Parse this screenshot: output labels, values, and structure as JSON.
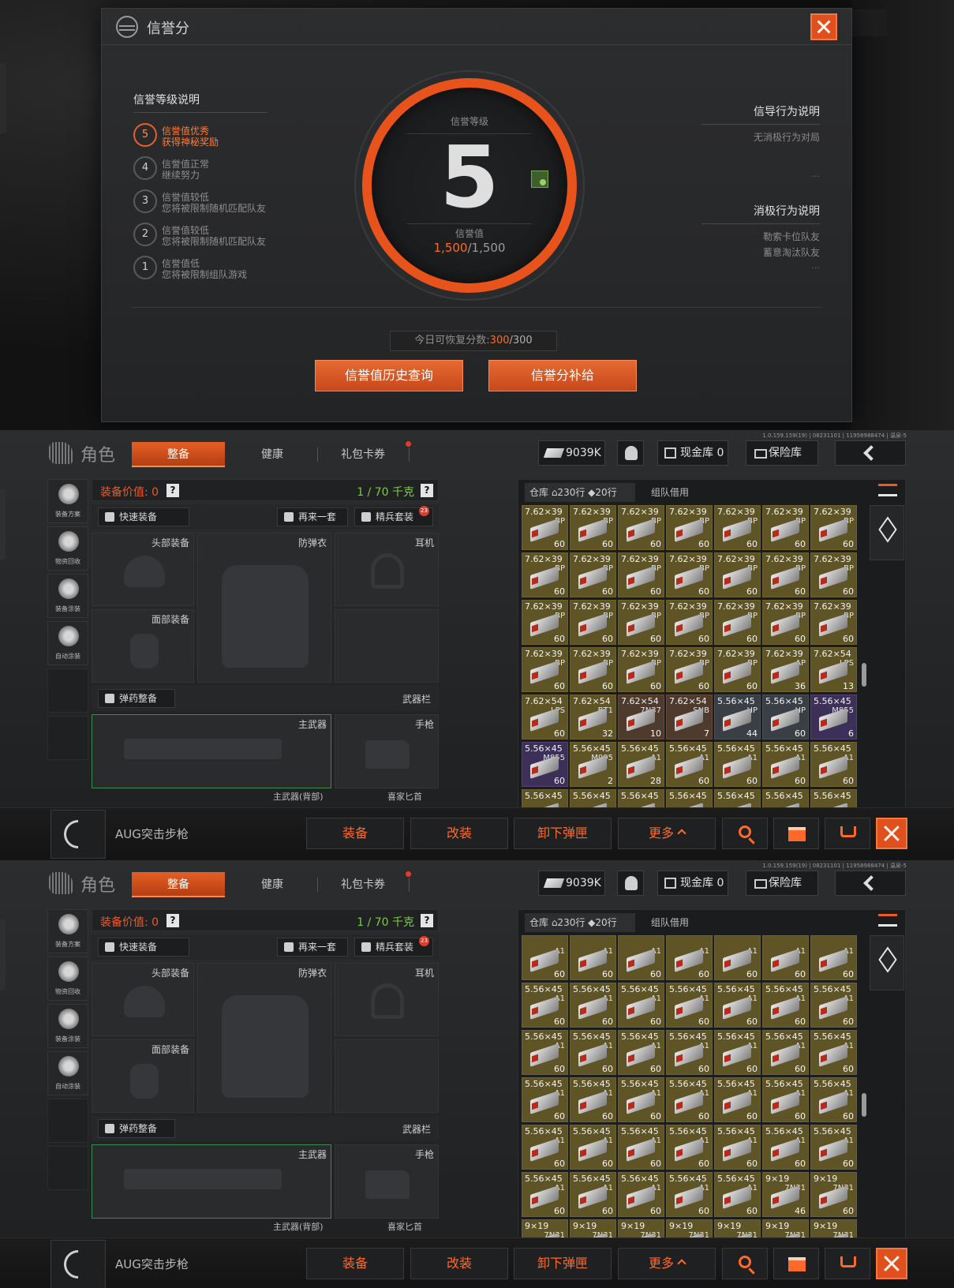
{
  "credit": {
    "title": "信誉分",
    "levels_title": "信誉等级说明",
    "levels": [
      {
        "num": "5",
        "line1": "信誉值优秀",
        "line2": "获得神秘奖励"
      },
      {
        "num": "4",
        "line1": "信誉值正常",
        "line2": "继续努力"
      },
      {
        "num": "3",
        "line1": "信誉值较低",
        "line2": "您将被限制随机匹配队友"
      },
      {
        "num": "2",
        "line1": "信誉值较低",
        "line2": "您将被限制随机匹配队友"
      },
      {
        "num": "1",
        "line1": "信誉值低",
        "line2": "您将被限制组队游戏"
      }
    ],
    "dial": {
      "level_label": "信誉等级",
      "level": "5",
      "value_label": "信誉值",
      "current": "1,500",
      "max": "/1,500"
    },
    "guide_title": "信导行为说明",
    "guide_desc": "无消极行为对局",
    "guide_more": "...",
    "negative_title": "消极行为说明",
    "negative_lines": [
      "勒索卡位队友",
      "蓄意淘汰队友"
    ],
    "negative_more": "...",
    "recover_label": "今日可恢复分数:",
    "recover_current": "300",
    "recover_max": "/300",
    "history_button": "信誉值历史查询",
    "supply_button": "信誉分补给"
  },
  "inventory": {
    "version": "1.0.159.159(19) | 08231101 | 11958988474 | 温泉-5",
    "role": "角色",
    "tabs": [
      "整备",
      "健康",
      "礼包卡券"
    ],
    "money": "9039K",
    "cash_label": "现金库 0",
    "safe_label": "保险库",
    "side_tools": [
      "装备方案",
      "物资回收",
      "装备涂装",
      "自动涂装"
    ],
    "equip_value_label": "装备价值: 0",
    "weight_label": "1 / 70 千克",
    "help": "?",
    "quick_equip": "快速装备",
    "again": "再来一套",
    "elite": "精兵套装",
    "elite_badge": "23",
    "slots": {
      "head": "头部装备",
      "armor": "防弹衣",
      "ear": "耳机",
      "face": "面部装备",
      "ammo": "弹药整备",
      "weapon_bar": "武器栏",
      "main": "主武器",
      "pistol": "手枪",
      "main_back": "主武器(背部)",
      "melee": "喜家匕首"
    },
    "stash_tab": "仓库 ⌂230行 ◆20行",
    "team_tab": "组队借用",
    "weapon_name": "AUG突击步枪",
    "actions": [
      "装备",
      "改装",
      "卸下弹匣",
      "更多"
    ],
    "panel_a_cells": [
      {
        "cal": "7.62×39",
        "code": "BP",
        "cnt": "60",
        "c": "y"
      },
      {
        "cal": "7.62×39",
        "code": "BP",
        "cnt": "60",
        "c": "y"
      },
      {
        "cal": "7.62×39",
        "code": "BP",
        "cnt": "60",
        "c": "y"
      },
      {
        "cal": "7.62×39",
        "code": "BP",
        "cnt": "60",
        "c": "y"
      },
      {
        "cal": "7.62×39",
        "code": "BP",
        "cnt": "60",
        "c": "y"
      },
      {
        "cal": "7.62×39",
        "code": "BP",
        "cnt": "60",
        "c": "y"
      },
      {
        "cal": "7.62×39",
        "code": "BP",
        "cnt": "60",
        "c": "y"
      },
      {
        "cal": "7.62×39",
        "code": "BP",
        "cnt": "60",
        "c": "y"
      },
      {
        "cal": "7.62×39",
        "code": "BP",
        "cnt": "60",
        "c": "y"
      },
      {
        "cal": "7.62×39",
        "code": "BP",
        "cnt": "60",
        "c": "y"
      },
      {
        "cal": "7.62×39",
        "code": "BP",
        "cnt": "60",
        "c": "y"
      },
      {
        "cal": "7.62×39",
        "code": "BP",
        "cnt": "60",
        "c": "y"
      },
      {
        "cal": "7.62×39",
        "code": "BP",
        "cnt": "60",
        "c": "y"
      },
      {
        "cal": "7.62×39",
        "code": "BP",
        "cnt": "60",
        "c": "y"
      },
      {
        "cal": "7.62×39",
        "code": "BP",
        "cnt": "60",
        "c": "y"
      },
      {
        "cal": "7.62×39",
        "code": "BP",
        "cnt": "60",
        "c": "y"
      },
      {
        "cal": "7.62×39",
        "code": "BP",
        "cnt": "60",
        "c": "y"
      },
      {
        "cal": "7.62×39",
        "code": "BP",
        "cnt": "60",
        "c": "y"
      },
      {
        "cal": "7.62×39",
        "code": "BP",
        "cnt": "60",
        "c": "y"
      },
      {
        "cal": "7.62×39",
        "code": "BP",
        "cnt": "60",
        "c": "y"
      },
      {
        "cal": "7.62×39",
        "code": "BP",
        "cnt": "60",
        "c": "y"
      },
      {
        "cal": "7.62×39",
        "code": "BP",
        "cnt": "60",
        "c": "y"
      },
      {
        "cal": "7.62×39",
        "code": "BP",
        "cnt": "60",
        "c": "y"
      },
      {
        "cal": "7.62×39",
        "code": "BP",
        "cnt": "60",
        "c": "y"
      },
      {
        "cal": "7.62×39",
        "code": "BP",
        "cnt": "60",
        "c": "y"
      },
      {
        "cal": "7.62×39",
        "code": "BP",
        "cnt": "60",
        "c": "y"
      },
      {
        "cal": "7.62×39",
        "code": "AP",
        "cnt": "36",
        "c": "y"
      },
      {
        "cal": "7.62×54",
        "code": "LPS",
        "cnt": "13",
        "c": "y"
      },
      {
        "cal": "7.62×54",
        "code": "LPS",
        "cnt": "60",
        "c": "y"
      },
      {
        "cal": "7.62×54",
        "code": "BT1",
        "cnt": "32",
        "c": "y"
      },
      {
        "cal": "7.62×54",
        "code": "7N37",
        "cnt": "10",
        "c": "r"
      },
      {
        "cal": "7.62×54",
        "code": "SNB",
        "cnt": "7",
        "c": "r"
      },
      {
        "cal": "5.56×45",
        "code": "HP",
        "cnt": "44",
        "c": "s"
      },
      {
        "cal": "5.56×45",
        "code": "HP",
        "cnt": "60",
        "c": "s"
      },
      {
        "cal": "5.56×45",
        "code": "M855",
        "cnt": "6",
        "c": "p"
      },
      {
        "cal": "5.56×45",
        "code": "M855",
        "cnt": "60",
        "c": "p"
      },
      {
        "cal": "5.56×45",
        "code": "M995",
        "cnt": "2",
        "c": "y"
      },
      {
        "cal": "5.56×45",
        "code": "A1",
        "cnt": "28",
        "c": "y"
      },
      {
        "cal": "5.56×45",
        "code": "A1",
        "cnt": "60",
        "c": "y"
      },
      {
        "cal": "5.56×45",
        "code": "A1",
        "cnt": "60",
        "c": "y"
      },
      {
        "cal": "5.56×45",
        "code": "A1",
        "cnt": "60",
        "c": "y"
      },
      {
        "cal": "5.56×45",
        "code": "A1",
        "cnt": "60",
        "c": "y"
      },
      {
        "cal": "5.56×45",
        "code": "",
        "cnt": "",
        "c": "y"
      },
      {
        "cal": "5.56×45",
        "code": "",
        "cnt": "",
        "c": "y"
      },
      {
        "cal": "5.56×45",
        "code": "",
        "cnt": "",
        "c": "y"
      },
      {
        "cal": "5.56×45",
        "code": "",
        "cnt": "",
        "c": "y"
      },
      {
        "cal": "5.56×45",
        "code": "",
        "cnt": "",
        "c": "y"
      },
      {
        "cal": "5.56×45",
        "code": "",
        "cnt": "",
        "c": "y"
      },
      {
        "cal": "5.56×45",
        "code": "",
        "cnt": "",
        "c": "y"
      }
    ],
    "panel_b_cells": [
      {
        "cal": "",
        "code": "A1",
        "cnt": "60",
        "c": "y"
      },
      {
        "cal": "",
        "code": "A1",
        "cnt": "60",
        "c": "y"
      },
      {
        "cal": "",
        "code": "A1",
        "cnt": "60",
        "c": "y"
      },
      {
        "cal": "",
        "code": "A1",
        "cnt": "60",
        "c": "y"
      },
      {
        "cal": "",
        "code": "A1",
        "cnt": "60",
        "c": "y"
      },
      {
        "cal": "",
        "code": "A1",
        "cnt": "60",
        "c": "y"
      },
      {
        "cal": "",
        "code": "A1",
        "cnt": "60",
        "c": "y"
      },
      {
        "cal": "5.56×45",
        "code": "A1",
        "cnt": "60",
        "c": "y"
      },
      {
        "cal": "5.56×45",
        "code": "A1",
        "cnt": "60",
        "c": "y"
      },
      {
        "cal": "5.56×45",
        "code": "A1",
        "cnt": "60",
        "c": "y"
      },
      {
        "cal": "5.56×45",
        "code": "A1",
        "cnt": "60",
        "c": "y"
      },
      {
        "cal": "5.56×45",
        "code": "A1",
        "cnt": "60",
        "c": "y"
      },
      {
        "cal": "5.56×45",
        "code": "A1",
        "cnt": "60",
        "c": "y"
      },
      {
        "cal": "5.56×45",
        "code": "A1",
        "cnt": "60",
        "c": "y"
      },
      {
        "cal": "5.56×45",
        "code": "A1",
        "cnt": "60",
        "c": "y"
      },
      {
        "cal": "5.56×45",
        "code": "A1",
        "cnt": "60",
        "c": "y"
      },
      {
        "cal": "5.56×45",
        "code": "A1",
        "cnt": "60",
        "c": "y"
      },
      {
        "cal": "5.56×45",
        "code": "A1",
        "cnt": "60",
        "c": "y"
      },
      {
        "cal": "5.56×45",
        "code": "A1",
        "cnt": "60",
        "c": "y"
      },
      {
        "cal": "5.56×45",
        "code": "A1",
        "cnt": "60",
        "c": "y"
      },
      {
        "cal": "5.56×45",
        "code": "A1",
        "cnt": "60",
        "c": "y"
      },
      {
        "cal": "5.56×45",
        "code": "A1",
        "cnt": "60",
        "c": "y"
      },
      {
        "cal": "5.56×45",
        "code": "A1",
        "cnt": "60",
        "c": "y"
      },
      {
        "cal": "5.56×45",
        "code": "A1",
        "cnt": "60",
        "c": "y"
      },
      {
        "cal": "5.56×45",
        "code": "A1",
        "cnt": "60",
        "c": "y"
      },
      {
        "cal": "5.56×45",
        "code": "A1",
        "cnt": "60",
        "c": "y"
      },
      {
        "cal": "5.56×45",
        "code": "A1",
        "cnt": "60",
        "c": "y"
      },
      {
        "cal": "5.56×45",
        "code": "A1",
        "cnt": "60",
        "c": "y"
      },
      {
        "cal": "5.56×45",
        "code": "A1",
        "cnt": "60",
        "c": "y"
      },
      {
        "cal": "5.56×45",
        "code": "A1",
        "cnt": "60",
        "c": "y"
      },
      {
        "cal": "5.56×45",
        "code": "A1",
        "cnt": "60",
        "c": "y"
      },
      {
        "cal": "5.56×45",
        "code": "A1",
        "cnt": "60",
        "c": "y"
      },
      {
        "cal": "5.56×45",
        "code": "A1",
        "cnt": "60",
        "c": "y"
      },
      {
        "cal": "5.56×45",
        "code": "A1",
        "cnt": "60",
        "c": "y"
      },
      {
        "cal": "5.56×45",
        "code": "A1",
        "cnt": "60",
        "c": "y"
      },
      {
        "cal": "5.56×45",
        "code": "A1",
        "cnt": "60",
        "c": "y"
      },
      {
        "cal": "5.56×45",
        "code": "A1",
        "cnt": "60",
        "c": "y"
      },
      {
        "cal": "5.56×45",
        "code": "A1",
        "cnt": "60",
        "c": "y"
      },
      {
        "cal": "5.56×45",
        "code": "A1",
        "cnt": "60",
        "c": "y"
      },
      {
        "cal": "5.56×45",
        "code": "A1",
        "cnt": "60",
        "c": "y"
      },
      {
        "cal": "9×19",
        "code": "7N31",
        "cnt": "46",
        "c": "y"
      },
      {
        "cal": "9×19",
        "code": "7N31",
        "cnt": "60",
        "c": "y"
      },
      {
        "cal": "9×19",
        "code": "7N31",
        "cnt": "",
        "c": "y"
      },
      {
        "cal": "9×19",
        "code": "7N31",
        "cnt": "",
        "c": "y"
      },
      {
        "cal": "9×19",
        "code": "7N31",
        "cnt": "",
        "c": "y"
      },
      {
        "cal": "9×19",
        "code": "7N31",
        "cnt": "",
        "c": "y"
      },
      {
        "cal": "9×19",
        "code": "7N31",
        "cnt": "",
        "c": "y"
      },
      {
        "cal": "9×19",
        "code": "7N31",
        "cnt": "",
        "c": "y"
      },
      {
        "cal": "9×19",
        "code": "7N31",
        "cnt": "",
        "c": "y"
      }
    ]
  }
}
